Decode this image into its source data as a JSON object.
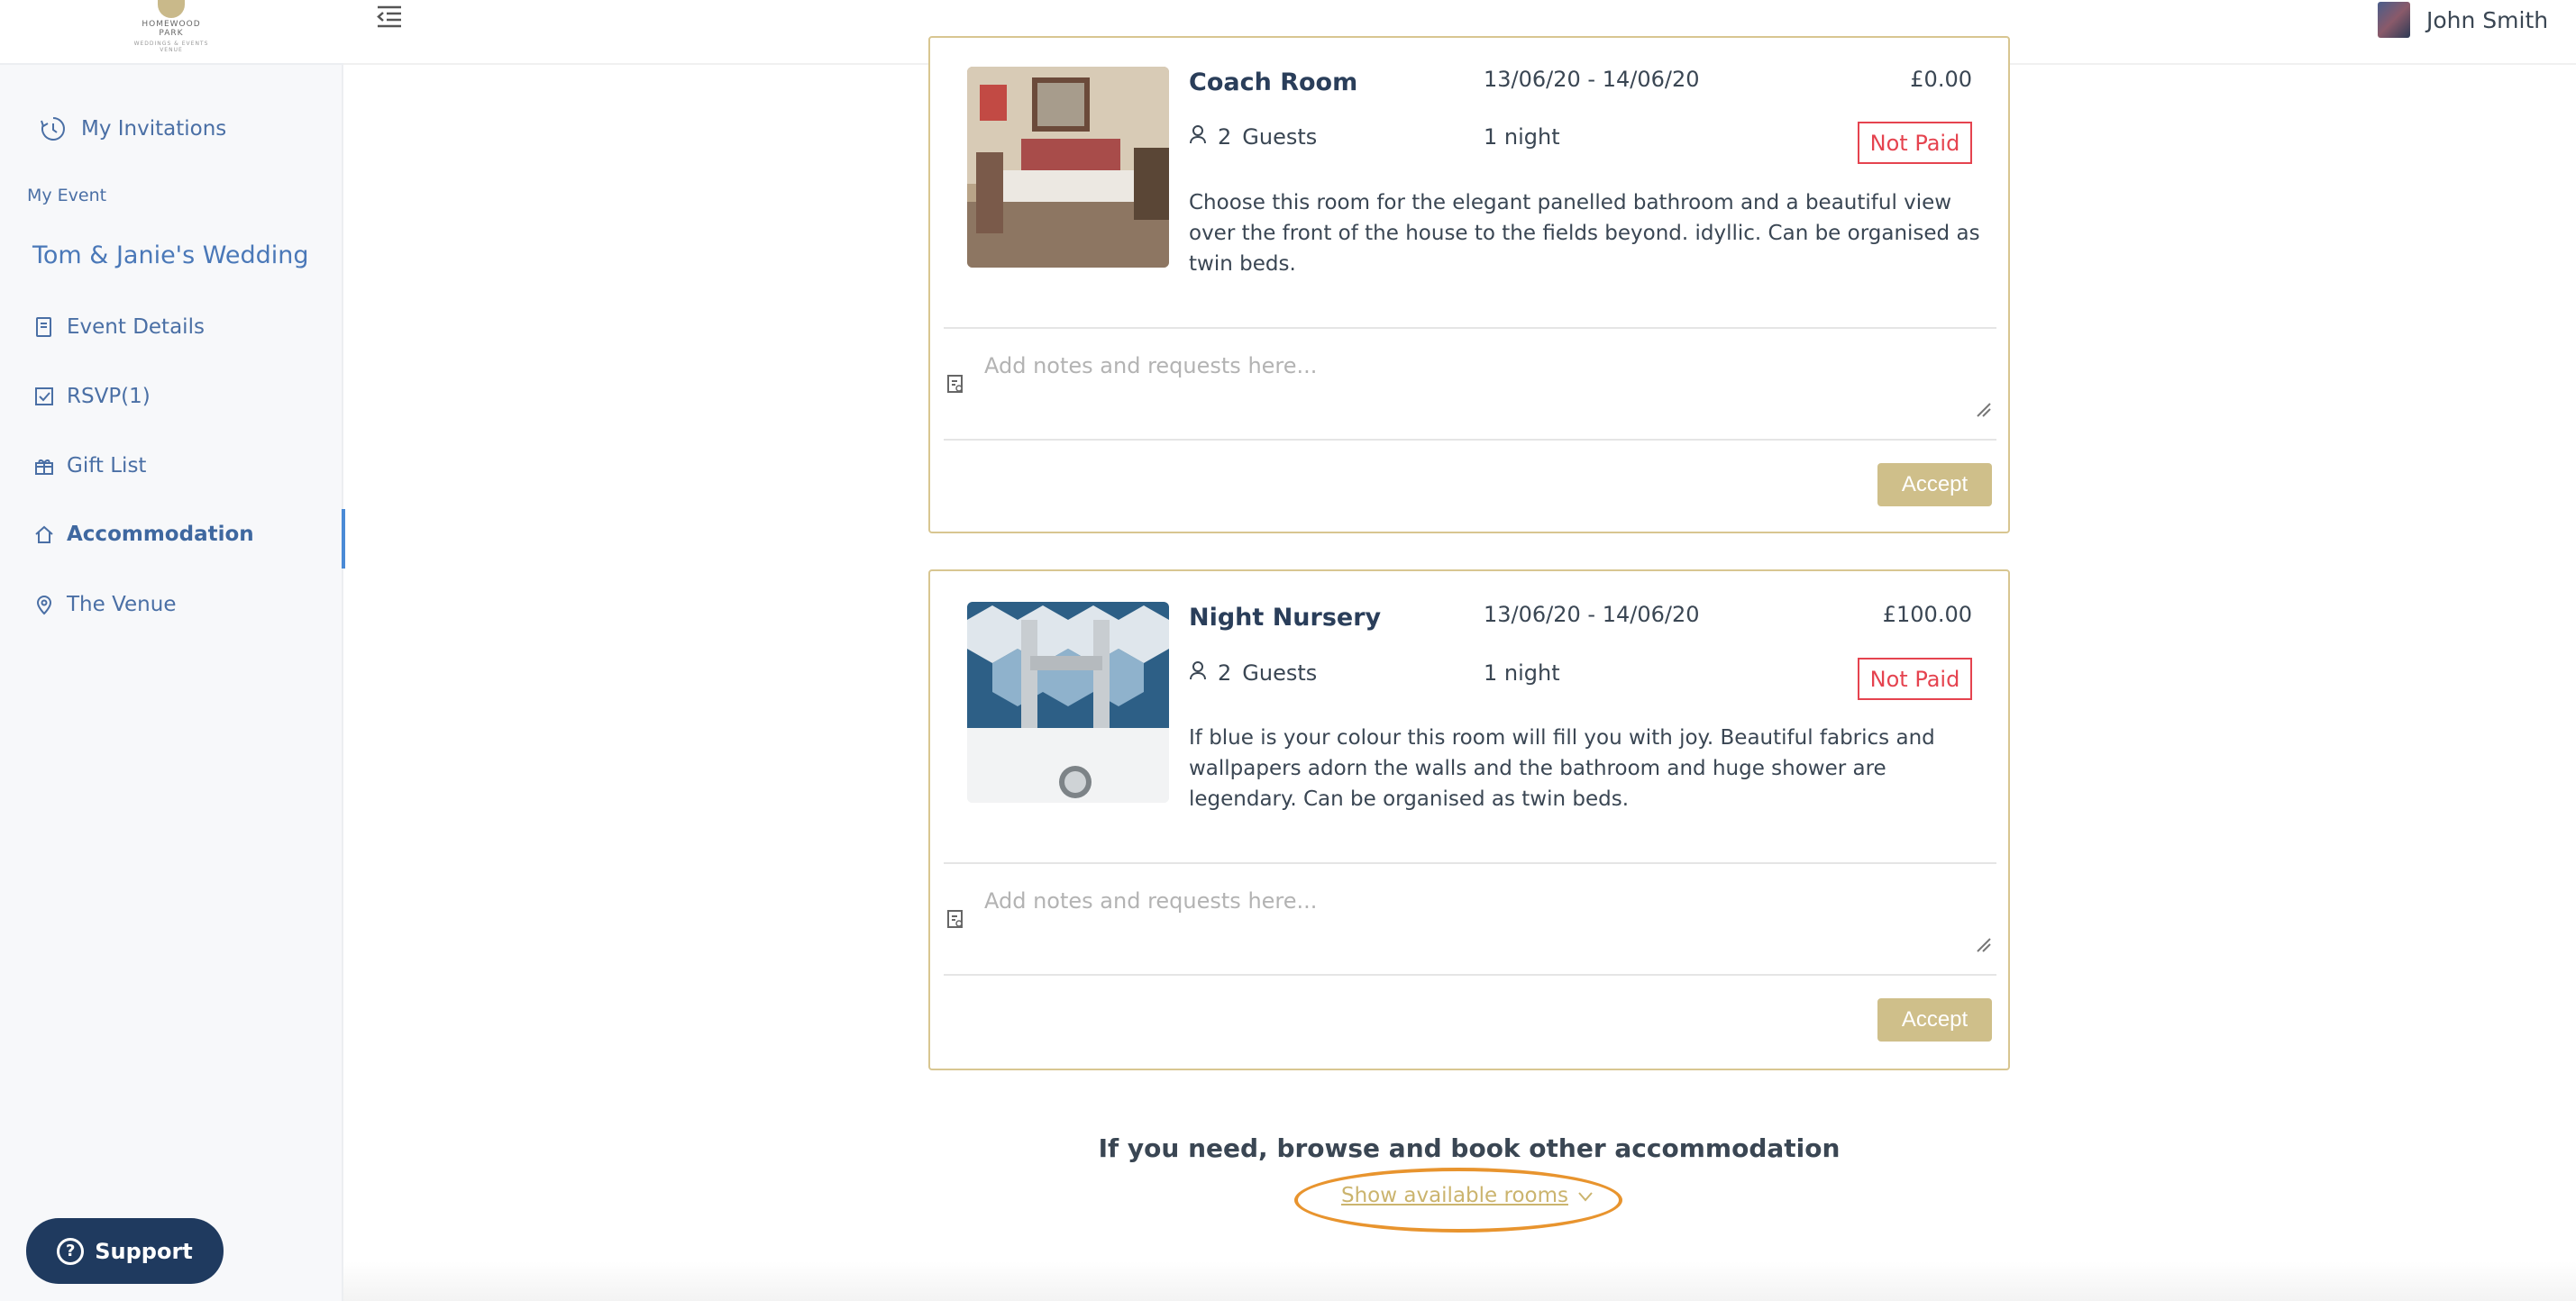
{
  "brand": {
    "line1": "HOMEWOOD",
    "line2": "PARK",
    "line3": "WEDDINGS & EVENTS VENUE"
  },
  "header": {
    "user_name": "John Smith"
  },
  "sidebar": {
    "my_invitations": "My Invitations",
    "section_label": "My Event",
    "event_name": "Tom & Janie's Wedding",
    "items": [
      {
        "label": "Event Details",
        "icon": "document-icon"
      },
      {
        "label": "RSVP(1)",
        "icon": "checkbox-icon"
      },
      {
        "label": "Gift List",
        "icon": "gift-icon"
      },
      {
        "label": "Accommodation",
        "icon": "house-icon",
        "active": true
      },
      {
        "label": "The Venue",
        "icon": "location-pin-icon"
      }
    ],
    "support_label": "Support"
  },
  "rooms": [
    {
      "title": "Coach Room",
      "dates": "13/06/20 - 14/06/20",
      "price": "£0.00",
      "guests_count": "2",
      "guests_label": "Guests",
      "nights": "1 night",
      "status": "Not Paid",
      "description": "Choose this room for the elegant panelled bathroom and a beautiful view over the front of the house to the fields beyond. idyllic. Can be organised as twin beds.",
      "notes_placeholder": "Add notes and requests here...",
      "accept_label": "Accept"
    },
    {
      "title": "Night Nursery",
      "dates": "13/06/20 - 14/06/20",
      "price": "£100.00",
      "guests_count": "2",
      "guests_label": "Guests",
      "nights": "1 night",
      "status": "Not Paid",
      "description": "If blue is your colour this room will fill you with joy. Beautiful fabrics and wallpapers adorn the walls and the bathroom and huge shower are legendary. Can be organised as twin beds.",
      "notes_placeholder": "Add notes and requests here...",
      "accept_label": "Accept"
    }
  ],
  "browse": {
    "heading": "If you need, browse and book other accommodation",
    "show_rooms_label": "Show available rooms"
  },
  "colors": {
    "accent_gold": "#cfbf8a",
    "link_blue": "#4a6fa5",
    "not_paid_red": "#e5434f",
    "highlight_orange": "#e8942e",
    "support_navy": "#1f3a5f"
  }
}
